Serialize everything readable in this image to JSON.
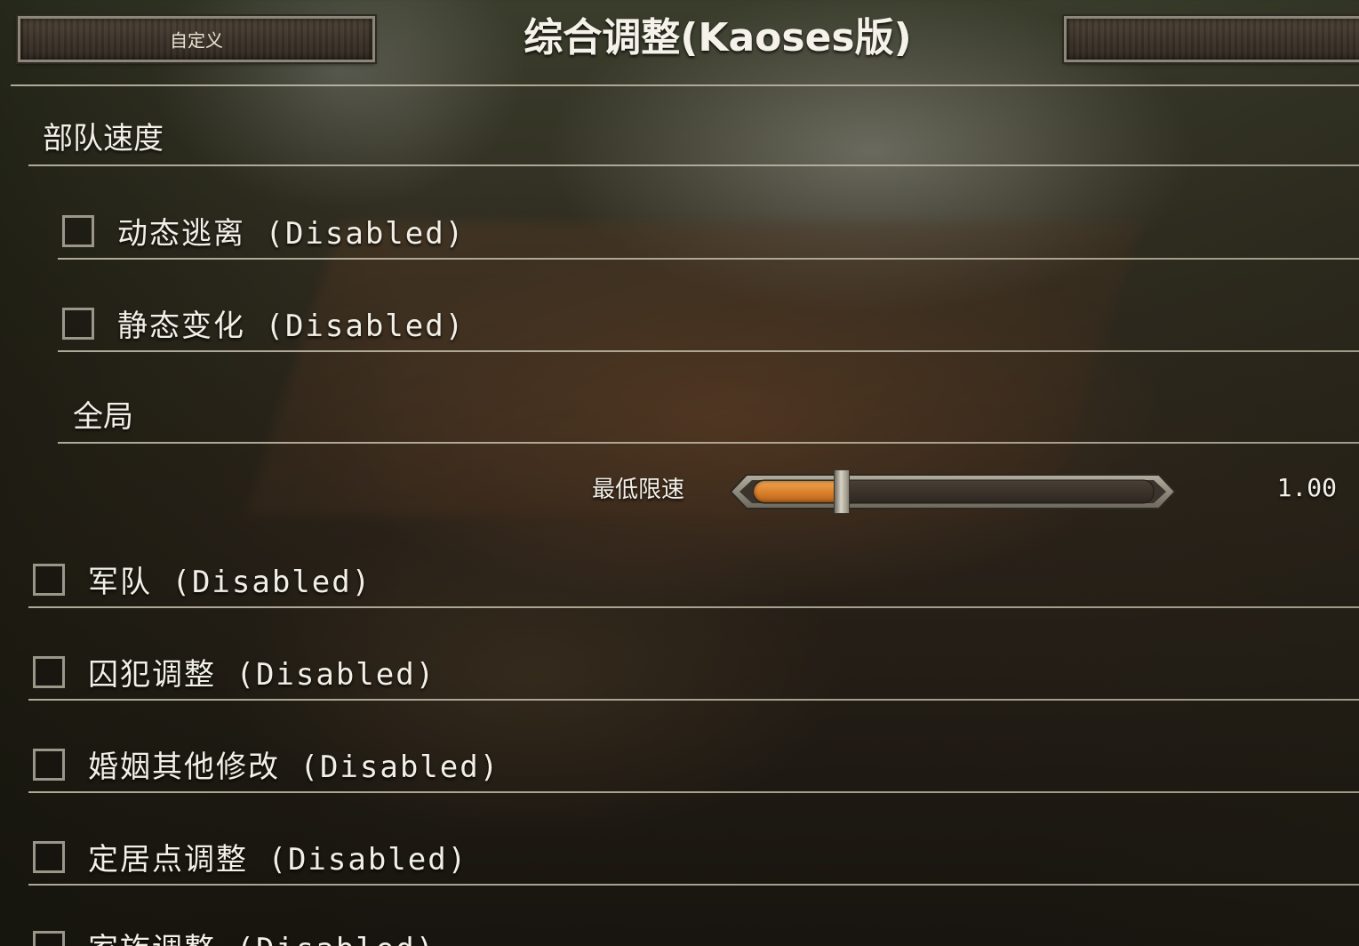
{
  "header": {
    "left_button_label": "自定义",
    "title": "综合调整(Kaoses版)",
    "right_button_label": ""
  },
  "section": {
    "title": "部队速度"
  },
  "options": [
    {
      "label": "动态逃离 (Disabled)",
      "checked": false
    },
    {
      "label": "静态变化 (Disabled)",
      "checked": false
    }
  ],
  "global_group": {
    "title": "全局",
    "slider": {
      "label": "最低限速",
      "value_text": "1.00",
      "fill_fraction": 0.22
    }
  },
  "more_options": [
    {
      "label": "军队 (Disabled)",
      "checked": false
    },
    {
      "label": "囚犯调整 (Disabled)",
      "checked": false
    },
    {
      "label": "婚姻其他修改 (Disabled)",
      "checked": false
    },
    {
      "label": "定居点调整 (Disabled)",
      "checked": false
    },
    {
      "label": "家族调整 (Disabled)",
      "checked": false
    }
  ],
  "colors": {
    "slider_fill": "#d97f2a",
    "text": "#f2efe6",
    "divider": "#c8c3af"
  }
}
